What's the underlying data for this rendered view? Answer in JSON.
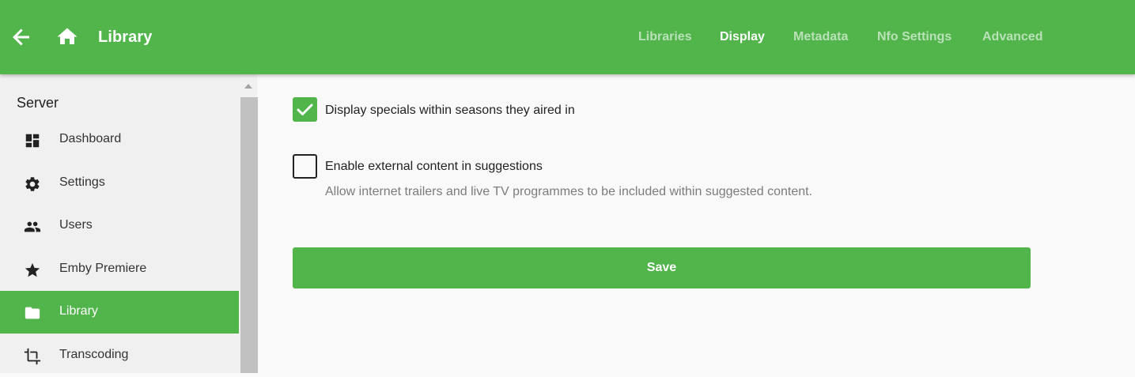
{
  "header": {
    "title": "Library",
    "back_icon": "arrow-left-icon",
    "home_icon": "home-icon",
    "background": "#52b54b",
    "tabs": [
      {
        "label": "Libraries",
        "active": false
      },
      {
        "label": "Display",
        "active": true
      },
      {
        "label": "Metadata",
        "active": false
      },
      {
        "label": "Nfo Settings",
        "active": false
      },
      {
        "label": "Advanced",
        "active": false
      }
    ]
  },
  "sidebar": {
    "section_title": "Server",
    "items": [
      {
        "label": "Dashboard",
        "icon": "dashboard-icon",
        "active": false
      },
      {
        "label": "Settings",
        "icon": "gear-icon",
        "active": false
      },
      {
        "label": "Users",
        "icon": "people-icon",
        "active": false
      },
      {
        "label": "Emby Premiere",
        "icon": "star-icon",
        "active": false
      },
      {
        "label": "Library",
        "icon": "folder-icon",
        "active": true
      },
      {
        "label": "Transcoding",
        "icon": "crop-icon",
        "active": false
      }
    ]
  },
  "main": {
    "options": [
      {
        "label": "Display specials within seasons they aired in",
        "checked": true
      },
      {
        "label": "Enable external content in suggestions",
        "description": "Allow internet trailers and live TV programmes to be included within suggested content.",
        "checked": false
      }
    ],
    "save_label": "Save"
  },
  "colors": {
    "accent": "#52b54b",
    "text": "#222222",
    "muted": "#7c7c7c"
  }
}
